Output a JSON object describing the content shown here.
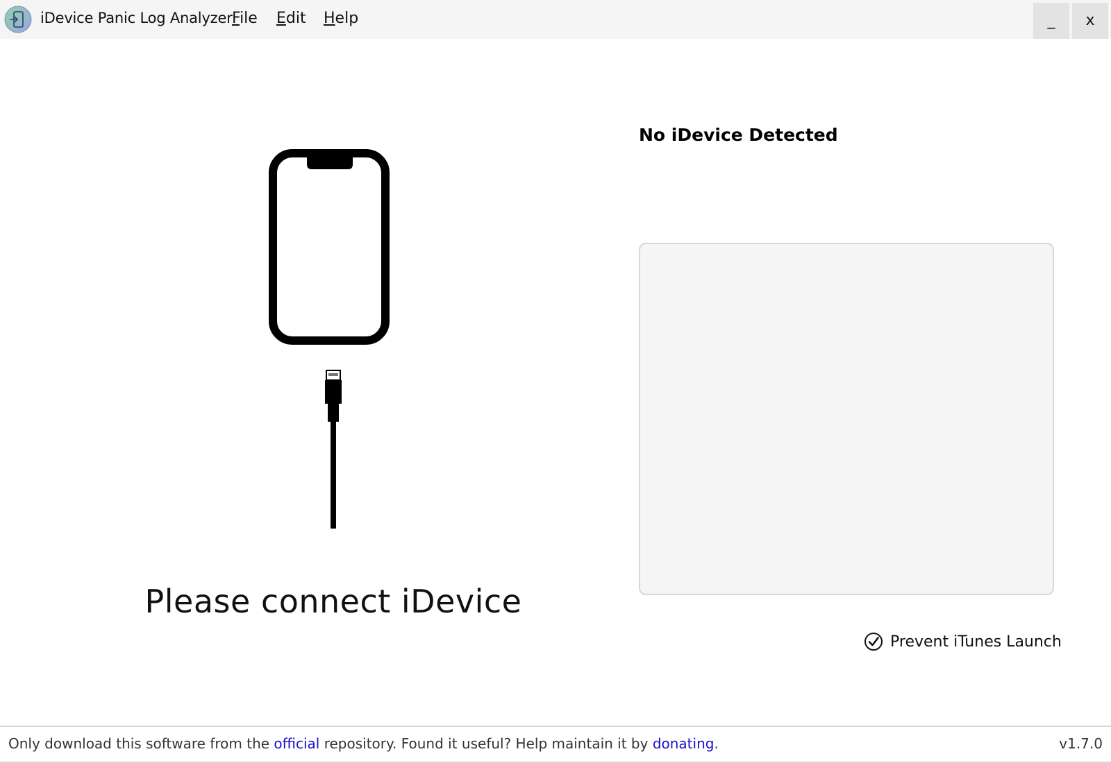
{
  "window": {
    "app_title": "iDevice Panic Log Analyzer",
    "menu": {
      "file": {
        "accel": "F",
        "rest": "ile"
      },
      "edit": {
        "accel": "E",
        "rest": "dit"
      },
      "help": {
        "accel": "H",
        "rest": "elp"
      }
    },
    "minimize_label": "_",
    "close_label": "x"
  },
  "left_panel": {
    "connect_prompt": "Please connect iDevice"
  },
  "right_panel": {
    "device_status": "No iDevice Detected",
    "prevent_itunes_label": "Prevent iTunes Launch",
    "prevent_itunes_checked": true
  },
  "footer": {
    "text_1": "Only download this software from the ",
    "link_official": "official",
    "text_2": " repository. Found it useful? Help maintain it by ",
    "link_donating": "donating",
    "text_3": ".",
    "version": "v1.7.0"
  },
  "colors": {
    "titlebar_bg": "#f5f5f5",
    "link": "#1a0dcc",
    "info_box_bg": "#f5f5f5"
  },
  "icons": {
    "app": "app-logo-icon",
    "phone": "iphone-icon",
    "cable": "lightning-cable-icon",
    "check": "check-circle-icon"
  }
}
